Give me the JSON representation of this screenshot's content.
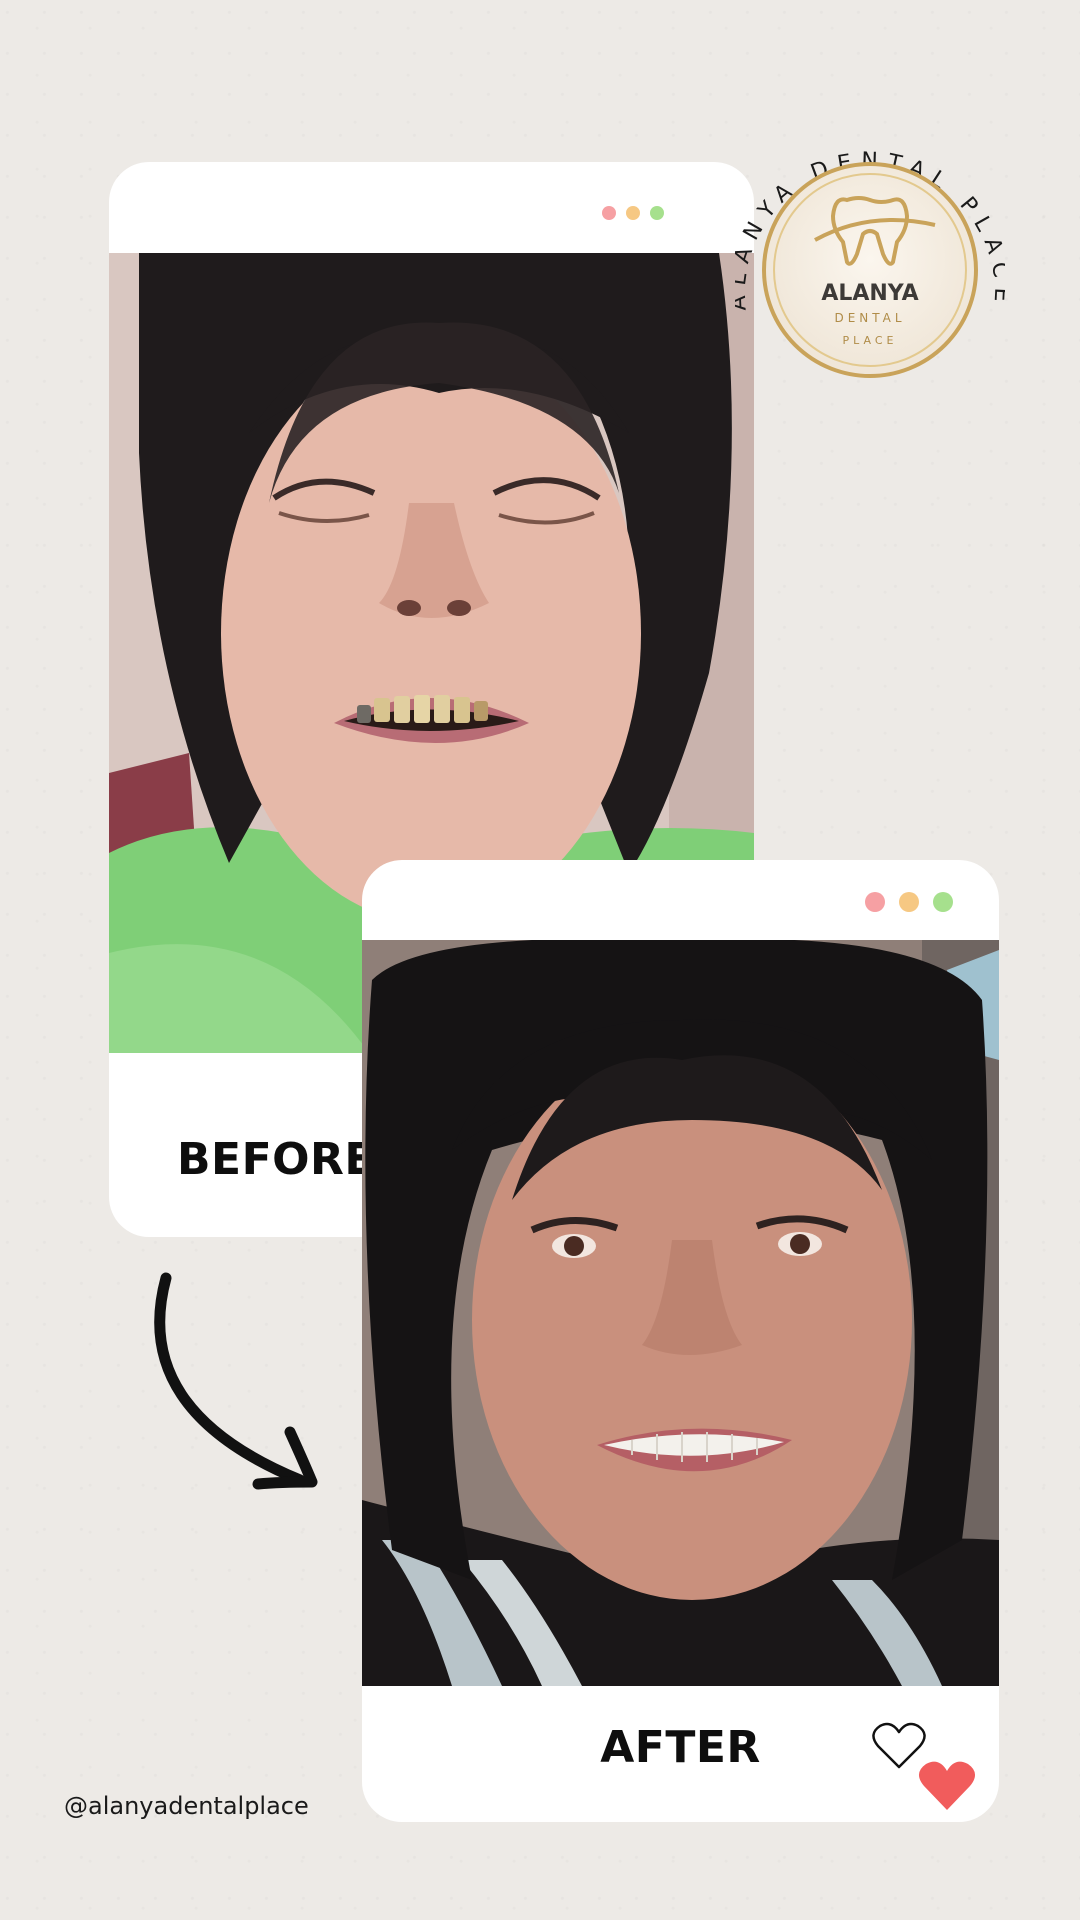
{
  "before_card": {
    "label": "BEFORE",
    "photo_icon": "before-portrait-image",
    "window_dots": [
      "#f6a0a3",
      "#f6c883",
      "#a6e08d"
    ]
  },
  "after_card": {
    "label": "AFTER",
    "photo_icon": "after-portrait-image",
    "window_dots": [
      "#f6a0a3",
      "#f6c883",
      "#a6e08d"
    ],
    "icons": [
      "heart-outline-icon",
      "heart-filled-icon"
    ]
  },
  "logo": {
    "ring_text": "ALANYA DENTAL PLACE",
    "name": "ALANYA",
    "line2": "DENTAL",
    "line3": "PLACE",
    "icon": "tooth-icon"
  },
  "arrow_icon": "curved-arrow-icon",
  "handle": "@alanyadentalplace",
  "colors": {
    "background": "#edeae6",
    "card": "#ffffff",
    "heart": "#f15c5c",
    "gold": "#c9a35a"
  }
}
